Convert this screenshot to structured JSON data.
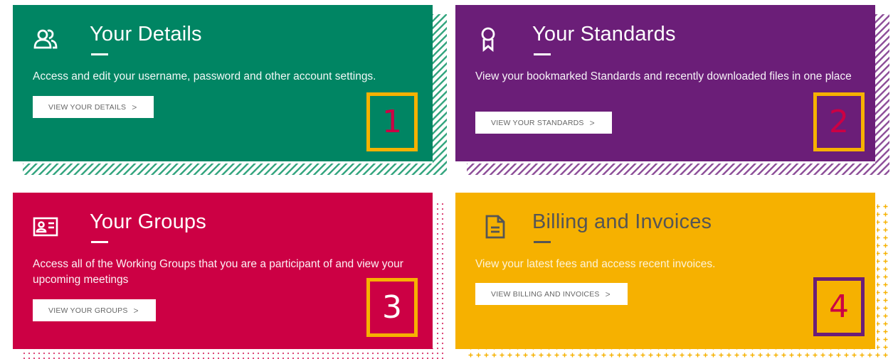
{
  "cards": [
    {
      "title": "Your Details",
      "description": "Access and edit your username, password and other account settings.",
      "button": "VIEW YOUR DETAILS",
      "number": "1",
      "color": "#008563",
      "pattern_color": "#2FA37C",
      "icon": "users-icon"
    },
    {
      "title": "Your Standards",
      "description": "View your bookmarked Standards and recently downloaded files in one place",
      "button": "VIEW YOUR STANDARDS",
      "number": "2",
      "color": "#6B1E78",
      "pattern_color": "#8B4B97",
      "icon": "award-ribbon-icon"
    },
    {
      "title": "Your Groups",
      "description": "Access all of the Working Groups that you are a participant of and view your upcoming meetings",
      "button": "VIEW YOUR GROUPS",
      "number": "3",
      "color": "#CC0044",
      "pattern_color": "#D9336A",
      "icon": "id-card-icon"
    },
    {
      "title": "Billing and Invoices",
      "description": "View your latest fees and access recent invoices.",
      "button": "VIEW BILLING AND INVOICES",
      "number": "4",
      "color": "#F6B100",
      "pattern_color": "#F6B100",
      "icon": "document-icon"
    }
  ],
  "number_colors": {
    "box": "#F6B100",
    "box4": "#6B1E78",
    "digit": "#CC0044"
  },
  "chevron": ">"
}
